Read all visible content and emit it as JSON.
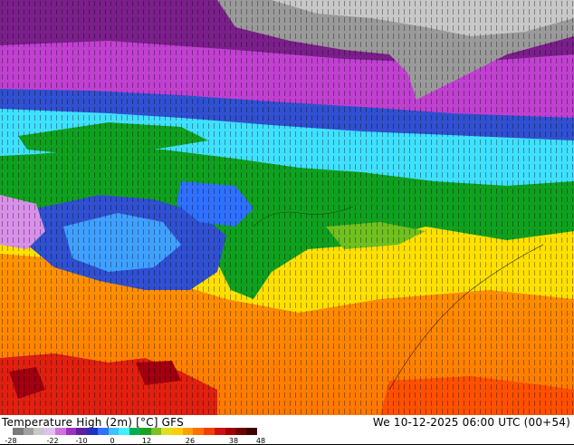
{
  "map": {
    "description_label": "GFS 2m temperature high map",
    "colors": {
      "arctic_gray": "#9a9a9a",
      "deep_purple": "#7a1f8a",
      "magenta": "#c040d0",
      "light_violet": "#d890e8",
      "blue": "#3050d0",
      "light_blue": "#40a0ff",
      "cyan": "#40e0ff",
      "green": "#10a020",
      "yellow_green": "#c0d020",
      "yellow": "#ffe000",
      "orange": "#ff9a00",
      "red": "#e02010",
      "dark_red": "#a00010"
    }
  },
  "footer": {
    "title": "Temperature High (2m) [°C] GFS",
    "datetime": "We 10-12-2025 06:00 UTC (00+54)"
  },
  "legend": {
    "ticks": [
      "-28",
      "-22",
      "-10",
      "0",
      "12",
      "26",
      "38",
      "48"
    ],
    "colors": [
      "#7a7a7a",
      "#a0a0a0",
      "#c8c8c8",
      "#e0c0f0",
      "#d070e0",
      "#a030c0",
      "#6020a0",
      "#2030c0",
      "#3070ff",
      "#40c0ff",
      "#40f0ff",
      "#00b050",
      "#20a020",
      "#80c020",
      "#e0e020",
      "#ffd000",
      "#ffa000",
      "#ff7000",
      "#f04000",
      "#d01010",
      "#a00000",
      "#700000",
      "#400000"
    ]
  }
}
